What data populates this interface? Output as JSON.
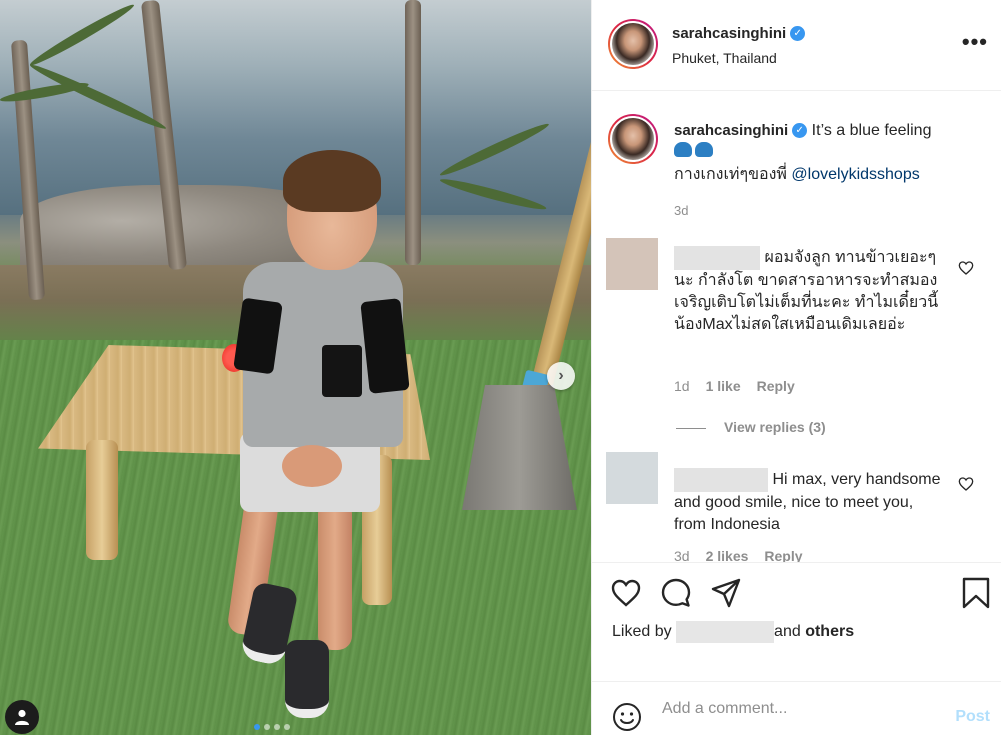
{
  "post": {
    "username": "sarahcasinghini",
    "location": "Phuket, Thailand",
    "verified_icon": "verified-badge",
    "more_label": "•••"
  },
  "photo": {
    "carousel_next_label": "›",
    "tag_icon": "user-tag-icon",
    "dots_count": 4,
    "active_dot": 0
  },
  "caption": {
    "username": "sarahcasinghini",
    "text": "It’s a blue feeling",
    "line2_prefix": "กางเกงเท่ๆของพี่ ",
    "mention": "@lovelykidsshops",
    "time": "3d"
  },
  "comments": [
    {
      "text": "ผอมจังลูก ทานข้าวเยอะๆนะ กำลังโต ขาดสารอาหารจะทำสมองเจริญเติบโตไม่เต็มที่นะคะ ทำไมเดี๋ยวนี้น้องMaxไม่สดใสเหมือนเดิมเลยอ่ะ",
      "time": "1d",
      "likes": "1 like",
      "reply": "Reply",
      "view_replies": "View replies (3)"
    },
    {
      "text": "Hi max, very handsome and good smile, nice to meet you, from Indonesia",
      "time": "3d",
      "likes": "2 likes",
      "reply": "Reply"
    }
  ],
  "actions": {
    "liked_by_prefix": "Liked by",
    "liked_by_suffix": "and",
    "others": "others"
  },
  "composer": {
    "placeholder": "Add a comment...",
    "post_label": "Post"
  },
  "colors": {
    "link": "#00376b",
    "verified": "#3897f0",
    "post_disabled": "#b2dffc"
  }
}
